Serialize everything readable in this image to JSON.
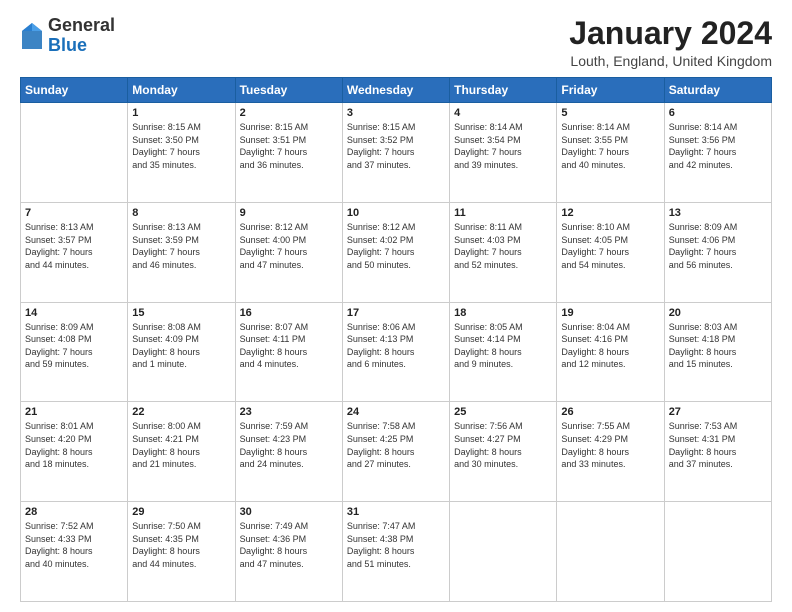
{
  "header": {
    "logo_general": "General",
    "logo_blue": "Blue",
    "month_title": "January 2024",
    "location": "Louth, England, United Kingdom"
  },
  "weekdays": [
    "Sunday",
    "Monday",
    "Tuesday",
    "Wednesday",
    "Thursday",
    "Friday",
    "Saturday"
  ],
  "weeks": [
    [
      {
        "day": "",
        "info": ""
      },
      {
        "day": "1",
        "info": "Sunrise: 8:15 AM\nSunset: 3:50 PM\nDaylight: 7 hours\nand 35 minutes."
      },
      {
        "day": "2",
        "info": "Sunrise: 8:15 AM\nSunset: 3:51 PM\nDaylight: 7 hours\nand 36 minutes."
      },
      {
        "day": "3",
        "info": "Sunrise: 8:15 AM\nSunset: 3:52 PM\nDaylight: 7 hours\nand 37 minutes."
      },
      {
        "day": "4",
        "info": "Sunrise: 8:14 AM\nSunset: 3:54 PM\nDaylight: 7 hours\nand 39 minutes."
      },
      {
        "day": "5",
        "info": "Sunrise: 8:14 AM\nSunset: 3:55 PM\nDaylight: 7 hours\nand 40 minutes."
      },
      {
        "day": "6",
        "info": "Sunrise: 8:14 AM\nSunset: 3:56 PM\nDaylight: 7 hours\nand 42 minutes."
      }
    ],
    [
      {
        "day": "7",
        "info": "Sunrise: 8:13 AM\nSunset: 3:57 PM\nDaylight: 7 hours\nand 44 minutes."
      },
      {
        "day": "8",
        "info": "Sunrise: 8:13 AM\nSunset: 3:59 PM\nDaylight: 7 hours\nand 46 minutes."
      },
      {
        "day": "9",
        "info": "Sunrise: 8:12 AM\nSunset: 4:00 PM\nDaylight: 7 hours\nand 47 minutes."
      },
      {
        "day": "10",
        "info": "Sunrise: 8:12 AM\nSunset: 4:02 PM\nDaylight: 7 hours\nand 50 minutes."
      },
      {
        "day": "11",
        "info": "Sunrise: 8:11 AM\nSunset: 4:03 PM\nDaylight: 7 hours\nand 52 minutes."
      },
      {
        "day": "12",
        "info": "Sunrise: 8:10 AM\nSunset: 4:05 PM\nDaylight: 7 hours\nand 54 minutes."
      },
      {
        "day": "13",
        "info": "Sunrise: 8:09 AM\nSunset: 4:06 PM\nDaylight: 7 hours\nand 56 minutes."
      }
    ],
    [
      {
        "day": "14",
        "info": "Sunrise: 8:09 AM\nSunset: 4:08 PM\nDaylight: 7 hours\nand 59 minutes."
      },
      {
        "day": "15",
        "info": "Sunrise: 8:08 AM\nSunset: 4:09 PM\nDaylight: 8 hours\nand 1 minute."
      },
      {
        "day": "16",
        "info": "Sunrise: 8:07 AM\nSunset: 4:11 PM\nDaylight: 8 hours\nand 4 minutes."
      },
      {
        "day": "17",
        "info": "Sunrise: 8:06 AM\nSunset: 4:13 PM\nDaylight: 8 hours\nand 6 minutes."
      },
      {
        "day": "18",
        "info": "Sunrise: 8:05 AM\nSunset: 4:14 PM\nDaylight: 8 hours\nand 9 minutes."
      },
      {
        "day": "19",
        "info": "Sunrise: 8:04 AM\nSunset: 4:16 PM\nDaylight: 8 hours\nand 12 minutes."
      },
      {
        "day": "20",
        "info": "Sunrise: 8:03 AM\nSunset: 4:18 PM\nDaylight: 8 hours\nand 15 minutes."
      }
    ],
    [
      {
        "day": "21",
        "info": "Sunrise: 8:01 AM\nSunset: 4:20 PM\nDaylight: 8 hours\nand 18 minutes."
      },
      {
        "day": "22",
        "info": "Sunrise: 8:00 AM\nSunset: 4:21 PM\nDaylight: 8 hours\nand 21 minutes."
      },
      {
        "day": "23",
        "info": "Sunrise: 7:59 AM\nSunset: 4:23 PM\nDaylight: 8 hours\nand 24 minutes."
      },
      {
        "day": "24",
        "info": "Sunrise: 7:58 AM\nSunset: 4:25 PM\nDaylight: 8 hours\nand 27 minutes."
      },
      {
        "day": "25",
        "info": "Sunrise: 7:56 AM\nSunset: 4:27 PM\nDaylight: 8 hours\nand 30 minutes."
      },
      {
        "day": "26",
        "info": "Sunrise: 7:55 AM\nSunset: 4:29 PM\nDaylight: 8 hours\nand 33 minutes."
      },
      {
        "day": "27",
        "info": "Sunrise: 7:53 AM\nSunset: 4:31 PM\nDaylight: 8 hours\nand 37 minutes."
      }
    ],
    [
      {
        "day": "28",
        "info": "Sunrise: 7:52 AM\nSunset: 4:33 PM\nDaylight: 8 hours\nand 40 minutes."
      },
      {
        "day": "29",
        "info": "Sunrise: 7:50 AM\nSunset: 4:35 PM\nDaylight: 8 hours\nand 44 minutes."
      },
      {
        "day": "30",
        "info": "Sunrise: 7:49 AM\nSunset: 4:36 PM\nDaylight: 8 hours\nand 47 minutes."
      },
      {
        "day": "31",
        "info": "Sunrise: 7:47 AM\nSunset: 4:38 PM\nDaylight: 8 hours\nand 51 minutes."
      },
      {
        "day": "",
        "info": ""
      },
      {
        "day": "",
        "info": ""
      },
      {
        "day": "",
        "info": ""
      }
    ]
  ]
}
